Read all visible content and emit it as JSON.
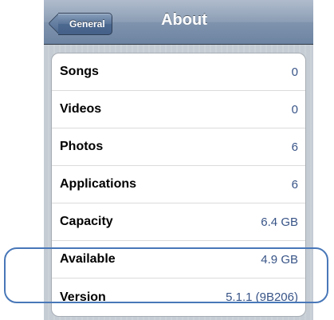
{
  "navbar": {
    "back_label": "General",
    "title": "About"
  },
  "rows": [
    {
      "label": "Songs",
      "value": "0"
    },
    {
      "label": "Videos",
      "value": "0"
    },
    {
      "label": "Photos",
      "value": "6"
    },
    {
      "label": "Applications",
      "value": "6"
    },
    {
      "label": "Capacity",
      "value": "6.4 GB"
    },
    {
      "label": "Available",
      "value": "4.9 GB"
    },
    {
      "label": "Version",
      "value": "5.1.1 (9B206)"
    }
  ],
  "colors": {
    "value_text": "#385487",
    "highlight": "#4877b8"
  }
}
